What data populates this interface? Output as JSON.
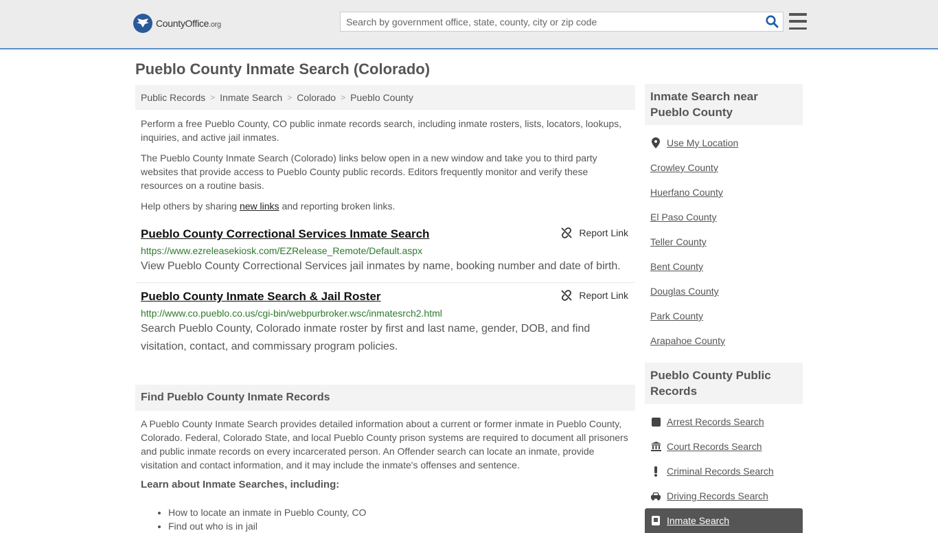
{
  "header": {
    "logo_main": "CountyOffice",
    "logo_ext": ".org",
    "search_placeholder": "Search by government office, state, county, city or zip code"
  },
  "page_title": "Pueblo County Inmate Search (Colorado)",
  "breadcrumb": [
    "Public Records",
    "Inmate Search",
    "Colorado",
    "Pueblo County"
  ],
  "intro": {
    "p1": "Perform a free Pueblo County, CO public inmate records search, including inmate rosters, lists, locators, lookups, inquiries, and active jail inmates.",
    "p2": "The Pueblo County Inmate Search (Colorado) links below open in a new window and take you to third party websites that provide access to Pueblo County public records. Editors frequently monitor and verify these resources on a routine basis.",
    "p3_before": "Help others by sharing ",
    "p3_link": "new links",
    "p3_after": " and reporting broken links."
  },
  "links": [
    {
      "title": "Pueblo County Correctional Services Inmate Search",
      "url": "https://www.ezreleasekiosk.com/EZRelease_Remote/Default.aspx",
      "desc": "View Pueblo County Correctional Services jail inmates by name, booking number and date of birth.",
      "report": "Report Link"
    },
    {
      "title": "Pueblo County Inmate Search & Jail Roster",
      "url": "http://www.co.pueblo.co.us/cgi-bin/webpurbroker.wsc/inmatesrch2.html",
      "desc": "Search Pueblo County, Colorado inmate roster by first and last name, gender, DOB, and find visitation, contact, and commissary program policies.",
      "report": "Report Link"
    }
  ],
  "find_section": {
    "heading": "Find Pueblo County Inmate Records",
    "body": "A Pueblo County Inmate Search provides detailed information about a current or former inmate in Pueblo County, Colorado. Federal, Colorado State, and local Pueblo County prison systems are required to document all prisoners and public inmate records on every incarcerated person. An Offender search can locate an inmate, provide visitation and contact information, and it may include the inmate's offenses and sentence.",
    "learn": "Learn about Inmate Searches, including:",
    "bullets": [
      "How to locate an inmate in Pueblo County, CO",
      "Find out who is in jail"
    ]
  },
  "sidebar": {
    "nearby_heading": "Inmate Search near Pueblo County",
    "nearby": [
      "Use My Location",
      "Crowley County",
      "Huerfano County",
      "El Paso County",
      "Teller County",
      "Bent County",
      "Douglas County",
      "Park County",
      "Arapahoe County"
    ],
    "records_heading": "Pueblo County Public Records",
    "records": [
      "Arrest Records Search",
      "Court Records Search",
      "Criminal Records Search",
      "Driving Records Search",
      "Inmate Search"
    ]
  }
}
